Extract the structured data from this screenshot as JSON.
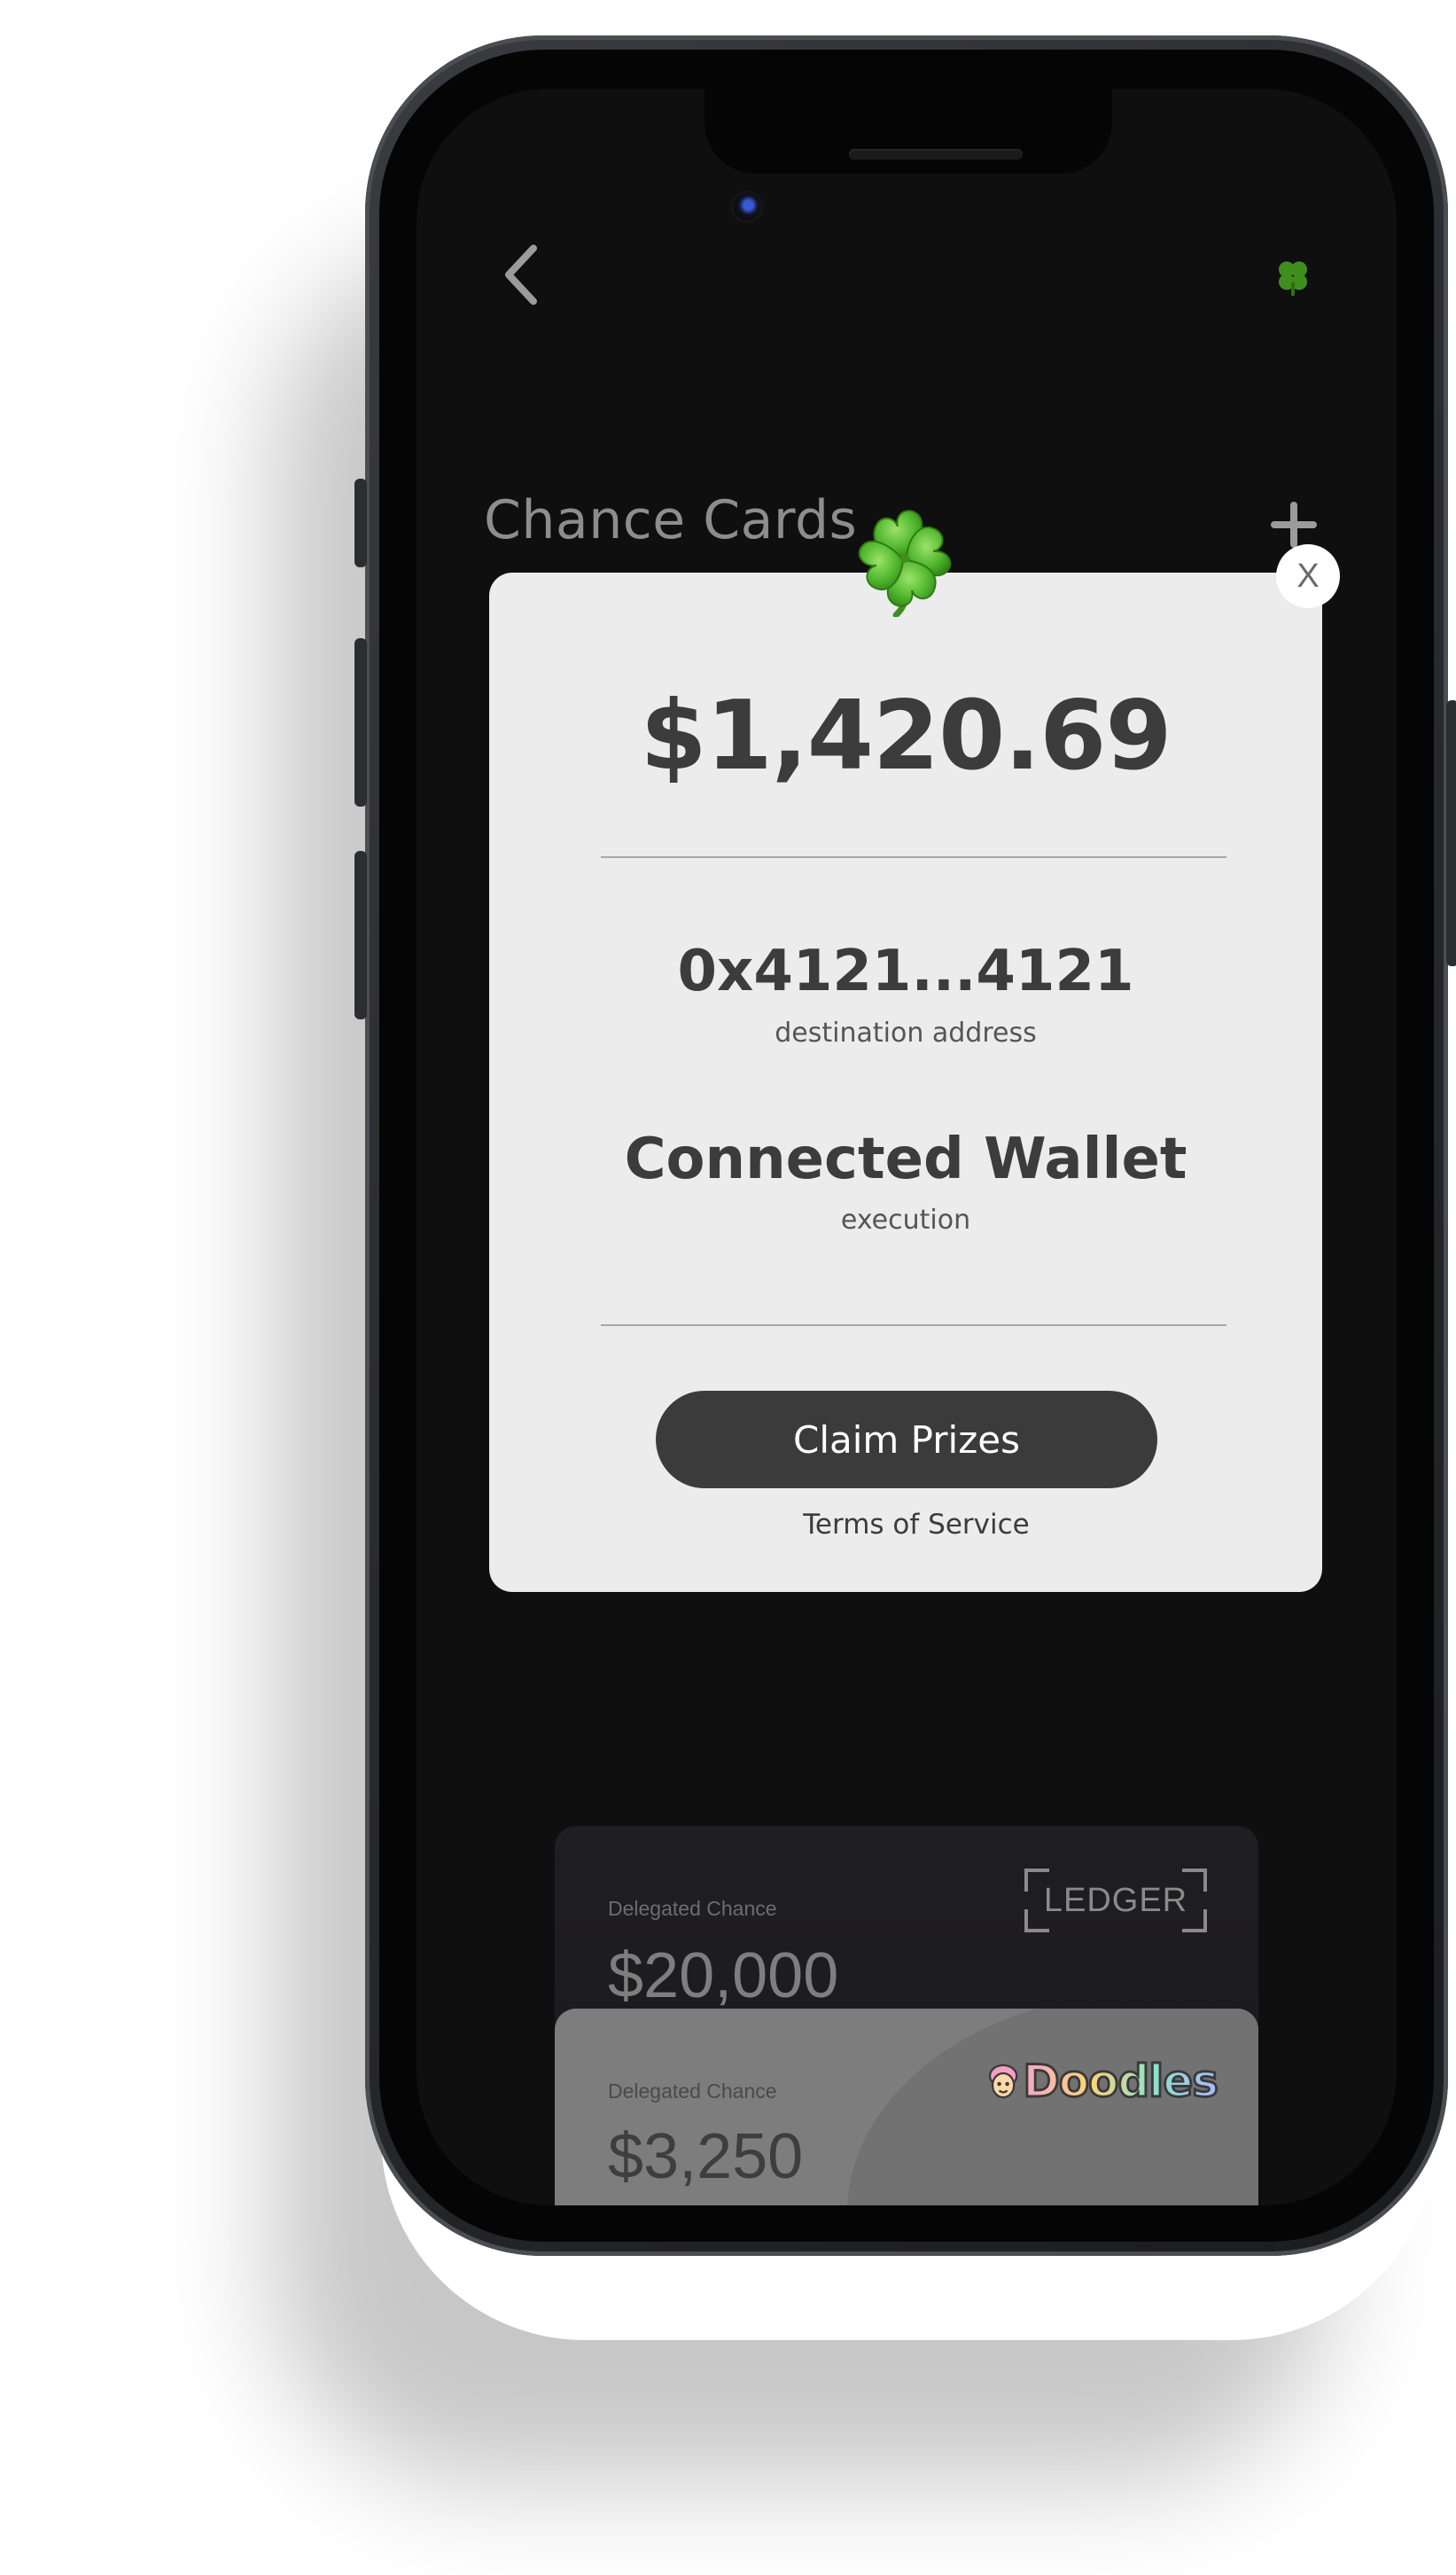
{
  "header": {
    "back_icon": "chevron-left-icon",
    "logo_icon": "four-leaf-clover-icon",
    "title": "Chance Cards",
    "add_icon": "plus-icon"
  },
  "modal": {
    "clover_icon": "four-leaf-clover-icon",
    "close_label": "X",
    "amount": "$1,420.69",
    "destination_address": "0x4121...4121",
    "destination_label": "destination address",
    "wallet": "Connected Wallet",
    "wallet_label": "execution",
    "claim_label": "Claim Prizes",
    "terms_label": "Terms of Service"
  },
  "cards": [
    {
      "kicker": "Delegated Chance",
      "amount": "$20,000",
      "brand": "LEDGER"
    },
    {
      "kicker": "Delegated Chance",
      "amount": "$3,250",
      "brand": "Doodles"
    }
  ],
  "colors": {
    "screen_bg": "#0f0f10",
    "modal_bg": "#ececec",
    "button_bg": "#3b3b3b",
    "clover_green": "#3c8e1a"
  }
}
